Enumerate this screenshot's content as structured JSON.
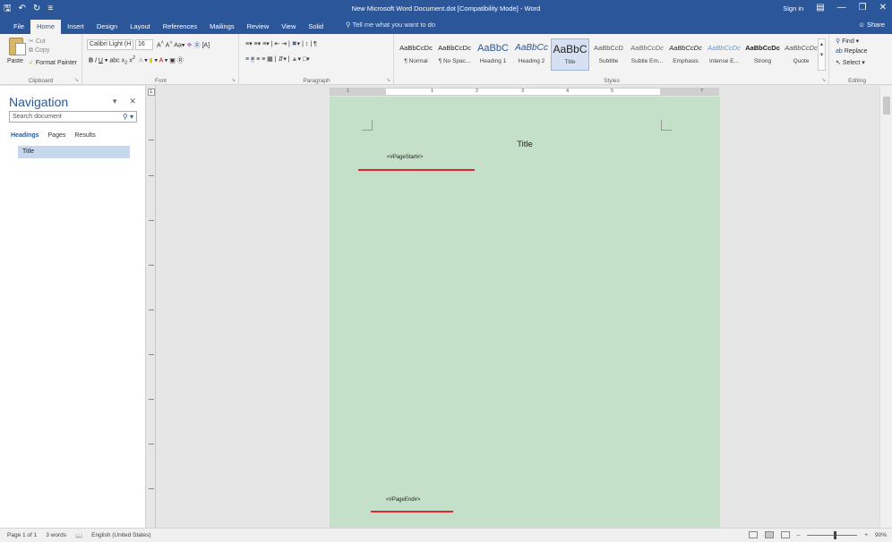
{
  "titlebar": {
    "save_icon": "save-icon",
    "undo_icon": "undo-icon",
    "redo_icon": "redo-icon",
    "customize_icon": "customize-qat-icon",
    "title": "New Microsoft Word Document.dot [Compatibility Mode] - Word",
    "sign_in": "Sign in",
    "ribbon_options_icon": "ribbon-display-icon"
  },
  "tabs": [
    "File",
    "Home",
    "Insert",
    "Design",
    "Layout",
    "References",
    "Mailings",
    "Review",
    "View",
    "Solid"
  ],
  "tell_me": "Tell me what you want to do",
  "share": "Share",
  "ribbon": {
    "clipboard": {
      "paste": "Paste",
      "cut": "Cut",
      "copy": "Copy",
      "format_painter": "Format Painter",
      "label": "Clipboard"
    },
    "font": {
      "font_name": "Calibri Light (H",
      "font_size": "16",
      "label": "Font"
    },
    "paragraph": {
      "label": "Paragraph"
    },
    "styles": {
      "label": "Styles",
      "items": [
        {
          "sample": "AaBbCcDc",
          "name": "¶ Normal"
        },
        {
          "sample": "AaBbCcDc",
          "name": "¶ No Spac..."
        },
        {
          "sample": "AaBbC",
          "name": "Heading 1"
        },
        {
          "sample": "AaBbCc",
          "name": "Heading 2"
        },
        {
          "sample": "AaBbC",
          "name": "Title"
        },
        {
          "sample": "AaBbCcD",
          "name": "Subtitle"
        },
        {
          "sample": "AaBbCcDc",
          "name": "Subtle Em..."
        },
        {
          "sample": "AaBbCcDc",
          "name": "Emphasis"
        },
        {
          "sample": "AaBbCcDc",
          "name": "Intense E..."
        },
        {
          "sample": "AaBbCcDc",
          "name": "Strong"
        },
        {
          "sample": "AaBbCcDc",
          "name": "Quote"
        }
      ]
    },
    "editing": {
      "find": "Find",
      "replace": "Replace",
      "select": "Select",
      "label": "Editing"
    }
  },
  "navigation": {
    "title": "Navigation",
    "search_placeholder": "Search document",
    "tabs": [
      "Headings",
      "Pages",
      "Results"
    ],
    "headings": [
      "Title"
    ]
  },
  "ruler": {
    "numbers": [
      "1",
      "1",
      "2",
      "3",
      "4",
      "5",
      "7"
    ]
  },
  "document": {
    "title": "Title",
    "page_start": "<#PageStart#>",
    "page_end": "<#PageEnd#>",
    "page_color": "#c5e0c8",
    "marker_line_color": "#e2242e"
  },
  "status": {
    "page": "Page 1 of 1",
    "words": "3 words",
    "language": "English (United States)",
    "zoom": "90%"
  }
}
